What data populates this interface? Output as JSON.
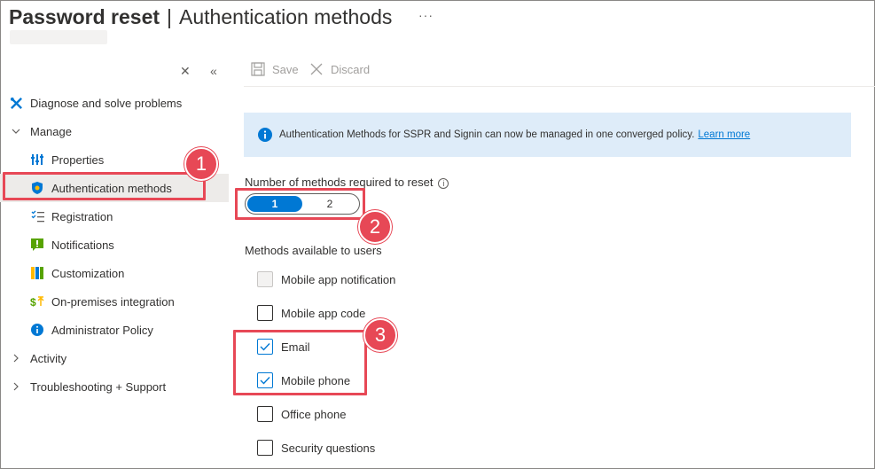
{
  "header": {
    "title_main": "Password reset",
    "title_separator": "|",
    "title_sub": "Authentication methods",
    "more_glyph": "···"
  },
  "sidebar": {
    "close_glyph": "✕",
    "collapse_glyph": "«",
    "items": [
      {
        "label": "Diagnose and solve problems",
        "icon": "wrench-icon",
        "level": 0
      },
      {
        "label": "Manage",
        "icon": "chevron-down-icon",
        "level": 0
      },
      {
        "label": "Properties",
        "icon": "properties-icon",
        "level": 1
      },
      {
        "label": "Authentication methods",
        "icon": "shield-icon",
        "level": 1,
        "selected": true
      },
      {
        "label": "Registration",
        "icon": "checklist-icon",
        "level": 1
      },
      {
        "label": "Notifications",
        "icon": "notification-icon",
        "level": 1
      },
      {
        "label": "Customization",
        "icon": "customization-icon",
        "level": 1
      },
      {
        "label": "On-premises integration",
        "icon": "sync-icon",
        "level": 1
      },
      {
        "label": "Administrator Policy",
        "icon": "info-icon",
        "level": 1
      },
      {
        "label": "Activity",
        "icon": "chevron-right-icon",
        "level": 0
      },
      {
        "label": "Troubleshooting + Support",
        "icon": "chevron-right-icon",
        "level": 0
      }
    ]
  },
  "toolbar": {
    "save_label": "Save",
    "discard_label": "Discard"
  },
  "info_banner": {
    "text": "Authentication Methods for SSPR and Signin can now be managed in one converged policy.",
    "link": "Learn more"
  },
  "methods_required": {
    "label": "Number of methods required to reset",
    "help_glyph": "i",
    "options": [
      "1",
      "2"
    ],
    "selected": "1"
  },
  "methods_available": {
    "label": "Methods available to users",
    "items": [
      {
        "label": "Mobile app notification",
        "checked": false,
        "disabled": true
      },
      {
        "label": "Mobile app code",
        "checked": false,
        "disabled": false
      },
      {
        "label": "Email",
        "checked": true,
        "disabled": false
      },
      {
        "label": "Mobile phone",
        "checked": true,
        "disabled": false
      },
      {
        "label": "Office phone",
        "checked": false,
        "disabled": false
      },
      {
        "label": "Security questions",
        "checked": false,
        "disabled": false
      }
    ]
  },
  "callouts": [
    "1",
    "2",
    "3"
  ],
  "colors": {
    "accent": "#0078d4",
    "callout": "#e74856",
    "info_bg": "#deecf9"
  }
}
